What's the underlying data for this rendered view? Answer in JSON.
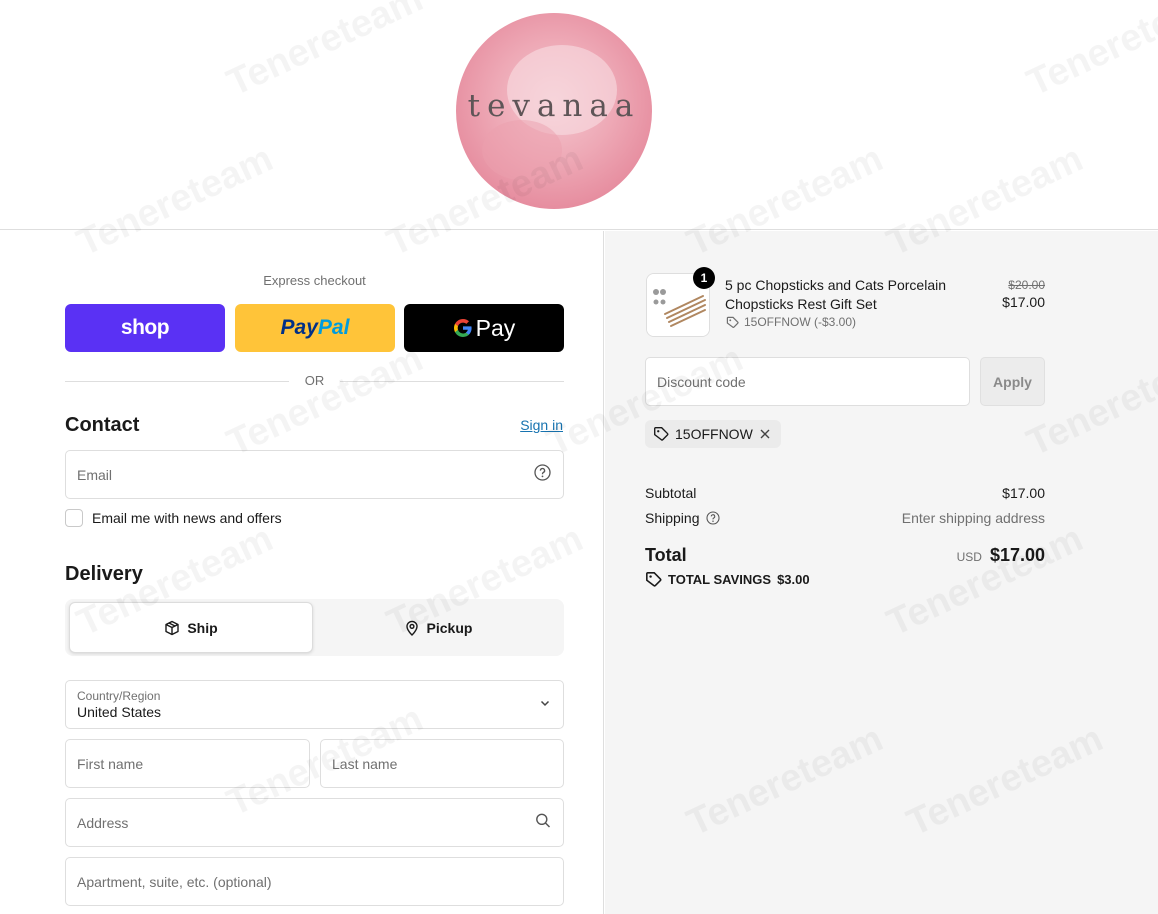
{
  "brand": {
    "logo_text": "tevanaa"
  },
  "express": {
    "title": "Express checkout",
    "shop_label": "shop",
    "paypal_label_a": "Pay",
    "paypal_label_b": "Pal",
    "gpay_label": "Pay",
    "or_text": "OR"
  },
  "contact": {
    "title": "Contact",
    "sign_in": "Sign in",
    "email_placeholder": "Email",
    "newsletter_label": "Email me with news and offers",
    "newsletter_checked": false
  },
  "delivery": {
    "title": "Delivery",
    "options": [
      {
        "label": "Ship",
        "icon": "box-icon",
        "selected": true
      },
      {
        "label": "Pickup",
        "icon": "map-pin-icon",
        "selected": false
      }
    ],
    "country_label": "Country/Region",
    "country_value": "United States",
    "first_name_placeholder": "First name",
    "last_name_placeholder": "Last name",
    "address_placeholder": "Address",
    "apartment_placeholder": "Apartment, suite, etc. (optional)"
  },
  "summary": {
    "item": {
      "name": "5 pc Chopsticks and Cats Porcelain Chopsticks Rest Gift Set",
      "quantity": "1",
      "discount": "15OFFNOW (-$3.00)",
      "original_price": "$20.00",
      "price": "$17.00"
    },
    "discount_placeholder": "Discount code",
    "apply_label": "Apply",
    "applied_code": "15OFFNOW",
    "subtotal_label": "Subtotal",
    "subtotal_value": "$17.00",
    "shipping_label": "Shipping",
    "shipping_value": "Enter shipping address",
    "total_label": "Total",
    "currency": "USD",
    "total_value": "$17.00",
    "savings_label": "TOTAL SAVINGS",
    "savings_value": "$3.00"
  },
  "watermark": {
    "text": "Tenereteam"
  },
  "colors": {
    "shop": "#5a31f4",
    "paypal": "#ffc439",
    "gpay": "#000000",
    "link": "#1773b0",
    "summary_bg": "#f5f5f5"
  }
}
